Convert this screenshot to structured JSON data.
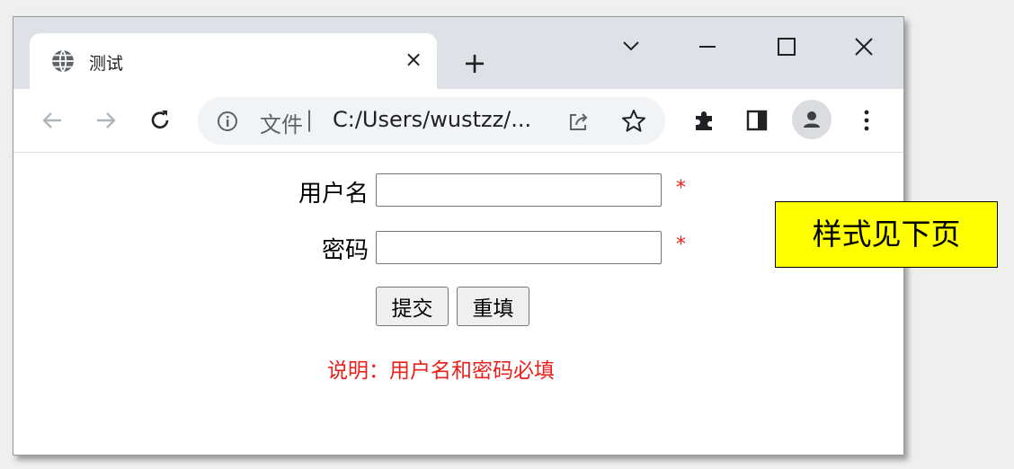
{
  "browser": {
    "tab_title": "测试",
    "tab_close": "×",
    "new_tab": "+",
    "favicon": "globe-icon",
    "address": {
      "scheme_label": "文件",
      "separator": "|",
      "url": "C:/Users/wustzz/..."
    }
  },
  "form": {
    "username_label": "用户名",
    "password_label": "密码",
    "required_mark": "*",
    "submit_label": "提交",
    "reset_label": "重填",
    "note": "说明：用户名和密码必填"
  },
  "callout": {
    "text": "样式见下页",
    "background": "#ffff00"
  },
  "colors": {
    "required": "#e8211c",
    "titlebar": "#dee1e6"
  }
}
